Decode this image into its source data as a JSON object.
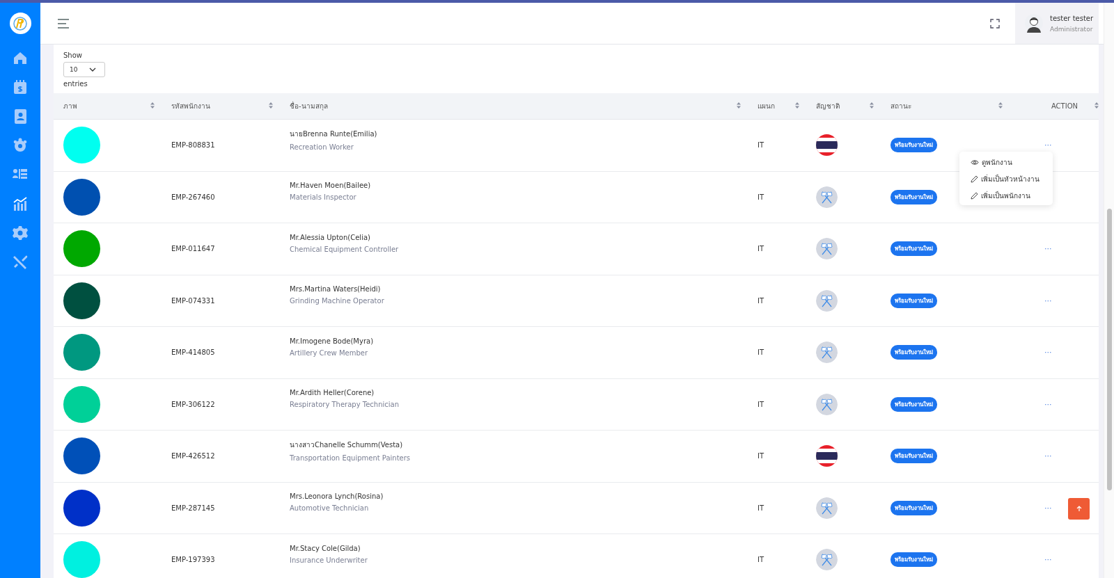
{
  "header": {
    "user": {
      "name": "tester tester",
      "role": "Administrator"
    }
  },
  "length_control": {
    "label_before": "Show",
    "value": "10",
    "label_after": "entries"
  },
  "table": {
    "columns": [
      "ภาพ",
      "รหัสพนักงาน",
      "ชื่อ-นามสกุล",
      "แผนก",
      "สัญชาติ",
      "สถานะ",
      "ACTION"
    ],
    "rows": [
      {
        "avatar": {
          "color": "#00fff0"
        },
        "code": "EMP-808831",
        "name": "นายBrenna Runte(Emilia)",
        "position": "Recreation Worker",
        "department": "IT",
        "flag": {
          "kind": "thai"
        },
        "status": "พร้อมรับงานใหม่",
        "action": "···",
        "menu_open": true
      },
      {
        "avatar": {
          "color": "#0050b0"
        },
        "code": "EMP-267460",
        "name": "Mr.Haven Moen(Bailee)",
        "position": "Materials Inspector",
        "department": "IT",
        "flag": {
          "kind": "generic"
        },
        "status": "พร้อมรับงานใหม่",
        "menu_open": false
      },
      {
        "avatar": {
          "color": "#00a800"
        },
        "code": "EMP-011647",
        "name": "Mr.Alessia Upton(Celia)",
        "position": "Chemical Equipment Controller",
        "department": "IT",
        "flag": {
          "kind": "generic"
        },
        "status": "พร้อมรับงานใหม่",
        "action": "···",
        "menu_open": false
      },
      {
        "avatar": {
          "color": "#005040"
        },
        "code": "EMP-074331",
        "name": "Mrs.Martina Waters(Heidi)",
        "position": "Grinding Machine Operator",
        "department": "IT",
        "flag": {
          "kind": "generic"
        },
        "status": "พร้อมรับงานใหม่",
        "action": "···",
        "menu_open": false
      },
      {
        "avatar": {
          "color": "#009880"
        },
        "code": "EMP-414805",
        "name": "Mr.Imogene Bode(Myra)",
        "position": "Artillery Crew Member",
        "department": "IT",
        "flag": {
          "kind": "generic"
        },
        "status": "พร้อมรับงานใหม่",
        "action": "···",
        "menu_open": false
      },
      {
        "avatar": {
          "color": "#00d098"
        },
        "code": "EMP-306122",
        "name": "Mr.Ardith Heller(Corene)",
        "position": "Respiratory Therapy Technician",
        "department": "IT",
        "flag": {
          "kind": "generic"
        },
        "status": "พร้อมรับงานใหม่",
        "action": "···",
        "menu_open": false
      },
      {
        "avatar": {
          "color": "#0050b8"
        },
        "code": "EMP-426512",
        "name": "นางสาวChanelle Schumm(Vesta)",
        "position": "Transportation Equipment Painters",
        "department": "IT",
        "flag": {
          "kind": "thai"
        },
        "status": "พร้อมรับงานใหม่",
        "action": "···",
        "menu_open": false
      },
      {
        "avatar": {
          "color": "#0030c8"
        },
        "code": "EMP-287145",
        "name": "Mrs.Leonora Lynch(Rosina)",
        "position": "Automotive Technician",
        "department": "IT",
        "flag": {
          "kind": "generic"
        },
        "status": "พร้อมรับงานใหม่",
        "action": "···",
        "menu_open": false
      },
      {
        "avatar": {
          "color": "#00f0e0"
        },
        "code": "EMP-197393",
        "name": "Mr.Stacy Cole(Gilda)",
        "position": "Insurance Underwriter",
        "department": "IT",
        "flag": {
          "kind": "generic"
        },
        "status": "พร้อมรับงานใหม่",
        "action": "···",
        "menu_open": false
      }
    ]
  },
  "action_menu": {
    "items": [
      {
        "kind": "view",
        "label": "ดูพนักงาน"
      },
      {
        "kind": "edit",
        "label": "เพิ่มเป็นหัวหน้างาน"
      },
      {
        "kind": "edit",
        "label": "เพิ่มเป็นพนักงาน"
      }
    ]
  }
}
